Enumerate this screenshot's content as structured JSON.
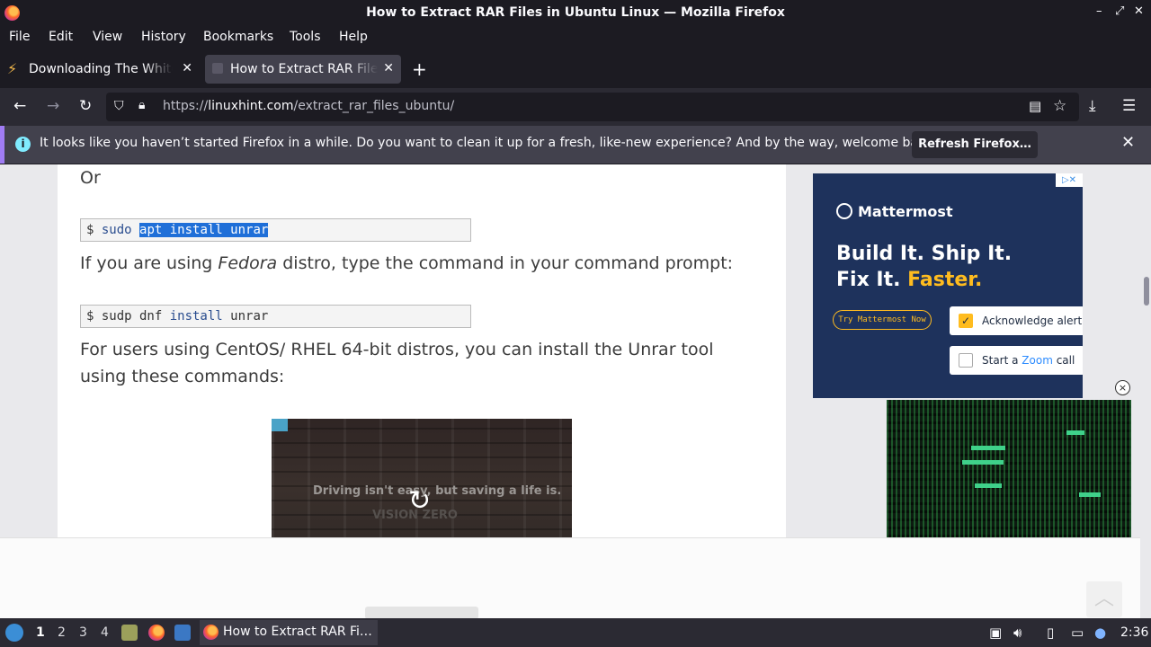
{
  "window": {
    "title": "How to Extract RAR Files in Ubuntu Linux — Mozilla Firefox",
    "controls": [
      "–",
      "⤢",
      "✕"
    ]
  },
  "menu": [
    "File",
    "Edit",
    "View",
    "History",
    "Bookmarks",
    "Tools",
    "Help"
  ],
  "tabs": [
    {
      "label": "Downloading The White House",
      "active": false
    },
    {
      "label": "How to Extract RAR Files in Ubuntu Linux",
      "active": true
    }
  ],
  "nav": {
    "url_prefix": "https://",
    "url_domain": "linuxhint.com",
    "url_path": "/extract_rar_files_ubuntu/"
  },
  "notification": {
    "message": "It looks like you haven’t started Firefox in a while. Do you want to clean it up for a fresh, like-new experience? And by the way, welcome back!",
    "button": "Refresh Firefox…",
    "accent_color": "#a07cf4"
  },
  "article": {
    "or_text": "Or",
    "code1_prompt": "$ ",
    "code1_cmd": "sudo",
    "code1_selected": "apt install unrar",
    "fedora_before": "If you are using ",
    "fedora_em": "Fedora",
    "fedora_after": " distro, type the command in your command prompt:",
    "code2_prompt": "$ ",
    "code2_a": "sudp dnf ",
    "code2_kw": "install",
    "code2_b": " unrar",
    "centos_text": "For users using CentOS/ RHEL 64-bit distros, you can install the Unrar tool using these commands:",
    "video_caption": "Driving isn't easy, but saving a life is.",
    "video_brand": "VISION ZERO",
    "replay_icon": "↻"
  },
  "ad": {
    "brand": "Mattermost",
    "headline1": "Build It. Ship It.",
    "headline2_a": "Fix It. ",
    "headline2_b": "Faster.",
    "cta": "Try Mattermost Now",
    "card1": "Acknowledge alert",
    "card2_a": "Start a ",
    "card2_zoom": "Zoom",
    "card2_b": " call",
    "adchoices": "▷✕",
    "close": "×",
    "highlight_color": "#ffbc1f"
  },
  "taskbar": {
    "workspaces": [
      "1",
      "2",
      "3",
      "4"
    ],
    "task_label": "How to Extract RAR Fi…",
    "clock": "2:36"
  }
}
